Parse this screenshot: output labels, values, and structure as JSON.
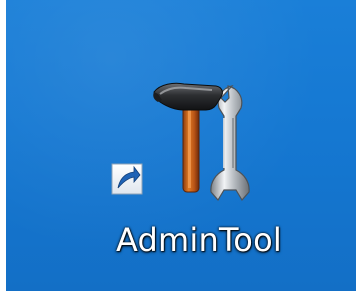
{
  "desktop": {
    "background_color": "#1578d2",
    "icons": [
      {
        "label": "AdminTool",
        "icon_name": "hammer-wrench-icon",
        "overlay_icon_name": "shortcut-arrow-icon"
      }
    ]
  }
}
